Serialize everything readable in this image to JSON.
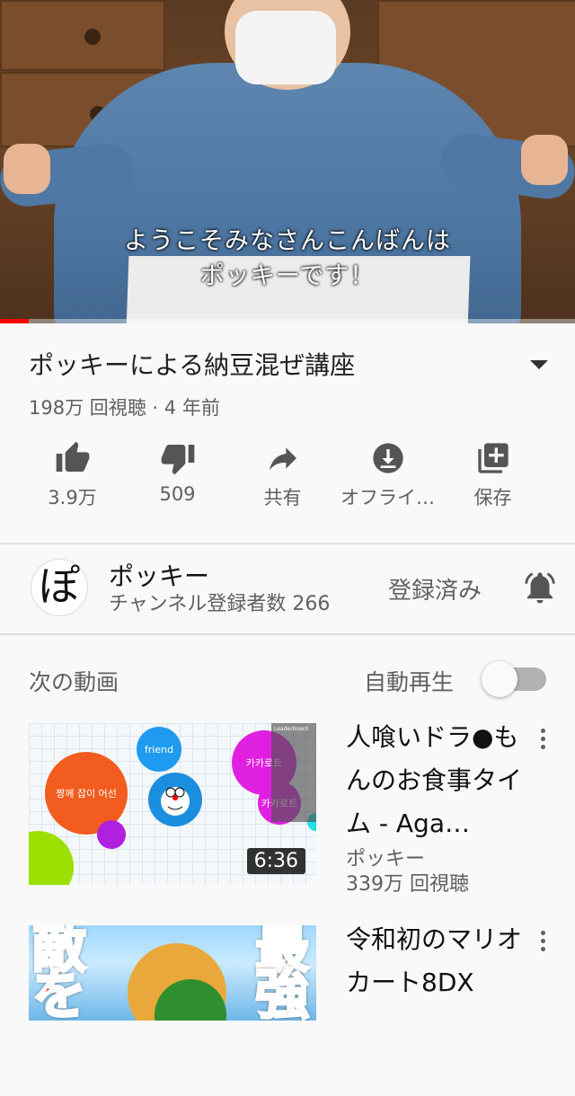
{
  "player": {
    "caption_line1": "ようこそみなさんこんばんは",
    "caption_line2": "ポッキーです！",
    "progress": 0.05
  },
  "video": {
    "title": "ポッキーによる納豆混ぜ講座",
    "meta": "198万 回視聴 · 4 年前"
  },
  "actions": [
    {
      "icon": "thumbs-up-icon",
      "label": "3.9万"
    },
    {
      "icon": "thumbs-down-icon",
      "label": "509"
    },
    {
      "icon": "share-icon",
      "label": "共有"
    },
    {
      "icon": "download-icon",
      "label": "オフライ…"
    },
    {
      "icon": "save-to-playlist-icon",
      "label": "保存"
    }
  ],
  "channel": {
    "avatar_text": "ぽ",
    "name": "ポッキー",
    "subscribers": "チャンネル登録者数 266",
    "subscribed_label": "登録済み"
  },
  "upnext": {
    "label": "次の動画",
    "autoplay_label": "自動再生",
    "autoplay_on": false
  },
  "items": [
    {
      "title": "人喰いドラ●もんのお食事タイム - Aga…",
      "channel": "ポッキー",
      "views": "339万 回視聴",
      "duration": "6:36",
      "thumb_texts": [
        "짱께 잡이 어선",
        "friend",
        "카카로트",
        "카카로트",
        "Leaderboard"
      ]
    },
    {
      "title": "令和初のマリオカート8DX",
      "thumb_texts": [
        "敵を",
        "最強"
      ]
    }
  ]
}
